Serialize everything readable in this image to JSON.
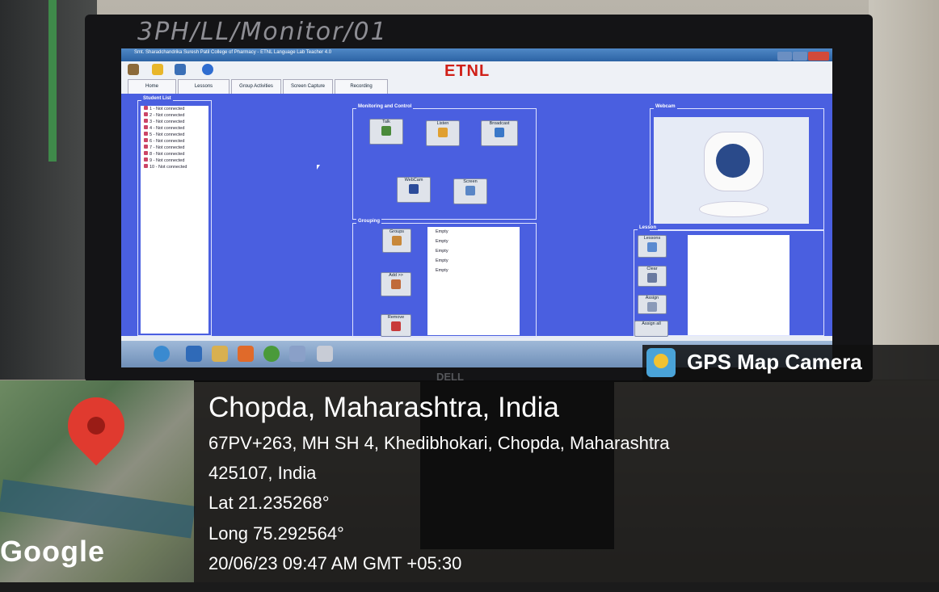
{
  "photo": {
    "bezel_label": "3PH/LL/Monitor/01",
    "monitor_brand": "DELL"
  },
  "app": {
    "title": "Smt. Sharadchandrika Suresh Patil College of Pharmacy - ETNL Language Lab Teacher 4.0",
    "logo": "ETNL",
    "tabs": [
      "Home",
      "Lessons",
      "Group Activities",
      "Screen Capture",
      "Recording"
    ],
    "student_list": {
      "title": "Student List",
      "items": [
        "1 - Not connected",
        "2 - Not connected",
        "3 - Not connected",
        "4 - Not connected",
        "5 - Not connected",
        "6 - Not connected",
        "7 - Not connected",
        "8 - Not connected",
        "9 - Not connected",
        "10 - Not connected"
      ]
    },
    "monitoring": {
      "title": "Monitoring and Control",
      "buttons": [
        "Talk",
        "Listen",
        "Broadcast",
        "WebCam",
        "Screen"
      ]
    },
    "grouping": {
      "title": "Grouping",
      "buttons": [
        "Groups",
        "Add >>",
        "Remove"
      ],
      "groups": [
        "Empty",
        "Empty",
        "Empty",
        "Empty",
        "Empty"
      ]
    },
    "webcam": {
      "title": "Webcam"
    },
    "lesson": {
      "title": "Lesson",
      "buttons": [
        "Lessons",
        "Clear",
        "Assign",
        "Assign all"
      ]
    }
  },
  "gps": {
    "brand": "GPS Map Camera",
    "place": "Chopda, Maharashtra, India",
    "address_line1": "67PV+263, MH SH 4, Khedibhokari, Chopda, Maharashtra",
    "address_line2": "425107, India",
    "lat": "Lat 21.235268°",
    "long": "Long 75.292564°",
    "datetime": "20/06/23 09:47 AM GMT +05:30",
    "map_provider": "Google"
  },
  "colors": {
    "app_bg": "#4a5fe0",
    "etnl_red": "#d02018",
    "pin_red": "#e03a2f"
  }
}
